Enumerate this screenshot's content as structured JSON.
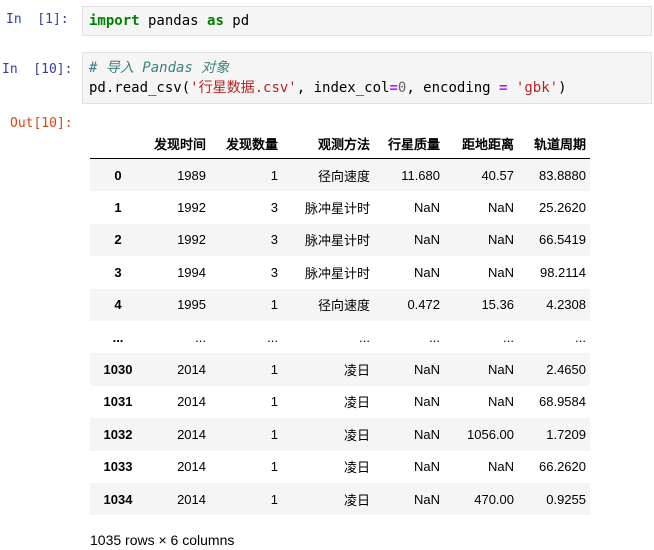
{
  "cells": [
    {
      "prompt": "In  [1]:",
      "code": {
        "kw_import": "import",
        "module": " pandas ",
        "kw_as": "as",
        "alias": " pd"
      }
    },
    {
      "prompt": "In  [10]:",
      "comment": "# 导入 Pandas 对象",
      "call": {
        "prefix": "pd.read_csv(",
        "path": "'行星数据.csv'",
        "mid1": ", index_col",
        "eq1": "=",
        "zero": "0",
        "mid2": ", encoding ",
        "eq2": "=",
        "space": " ",
        "enc": "'gbk'",
        "suffix": ")"
      }
    },
    {
      "prompt": "Out[10]:"
    }
  ],
  "table": {
    "columns": [
      "发现时间",
      "发现数量",
      "观测方法",
      "行星质量",
      "距地距离",
      "轨道周期"
    ],
    "rows": [
      {
        "index": "0",
        "values": [
          "1989",
          "1",
          "径向速度",
          "11.680",
          "40.57",
          "83.8880"
        ]
      },
      {
        "index": "1",
        "values": [
          "1992",
          "3",
          "脉冲星计时",
          "NaN",
          "NaN",
          "25.2620"
        ]
      },
      {
        "index": "2",
        "values": [
          "1992",
          "3",
          "脉冲星计时",
          "NaN",
          "NaN",
          "66.5419"
        ]
      },
      {
        "index": "3",
        "values": [
          "1994",
          "3",
          "脉冲星计时",
          "NaN",
          "NaN",
          "98.2114"
        ]
      },
      {
        "index": "4",
        "values": [
          "1995",
          "1",
          "径向速度",
          "0.472",
          "15.36",
          "4.2308"
        ]
      },
      {
        "index": "...",
        "values": [
          "...",
          "...",
          "...",
          "...",
          "...",
          "..."
        ]
      },
      {
        "index": "1030",
        "values": [
          "2014",
          "1",
          "凌日",
          "NaN",
          "NaN",
          "2.4650"
        ]
      },
      {
        "index": "1031",
        "values": [
          "2014",
          "1",
          "凌日",
          "NaN",
          "NaN",
          "68.9584"
        ]
      },
      {
        "index": "1032",
        "values": [
          "2014",
          "1",
          "凌日",
          "NaN",
          "1056.00",
          "1.7209"
        ]
      },
      {
        "index": "1033",
        "values": [
          "2014",
          "1",
          "凌日",
          "NaN",
          "NaN",
          "66.2620"
        ]
      },
      {
        "index": "1034",
        "values": [
          "2014",
          "1",
          "凌日",
          "NaN",
          "470.00",
          "0.9255"
        ]
      }
    ],
    "shape_text": "1035 rows × 6 columns"
  },
  "colors": {
    "in_prompt": "#303f9f",
    "out_prompt": "#d84315",
    "keyword": "#008000",
    "string": "#ba2121",
    "comment": "#408080"
  }
}
